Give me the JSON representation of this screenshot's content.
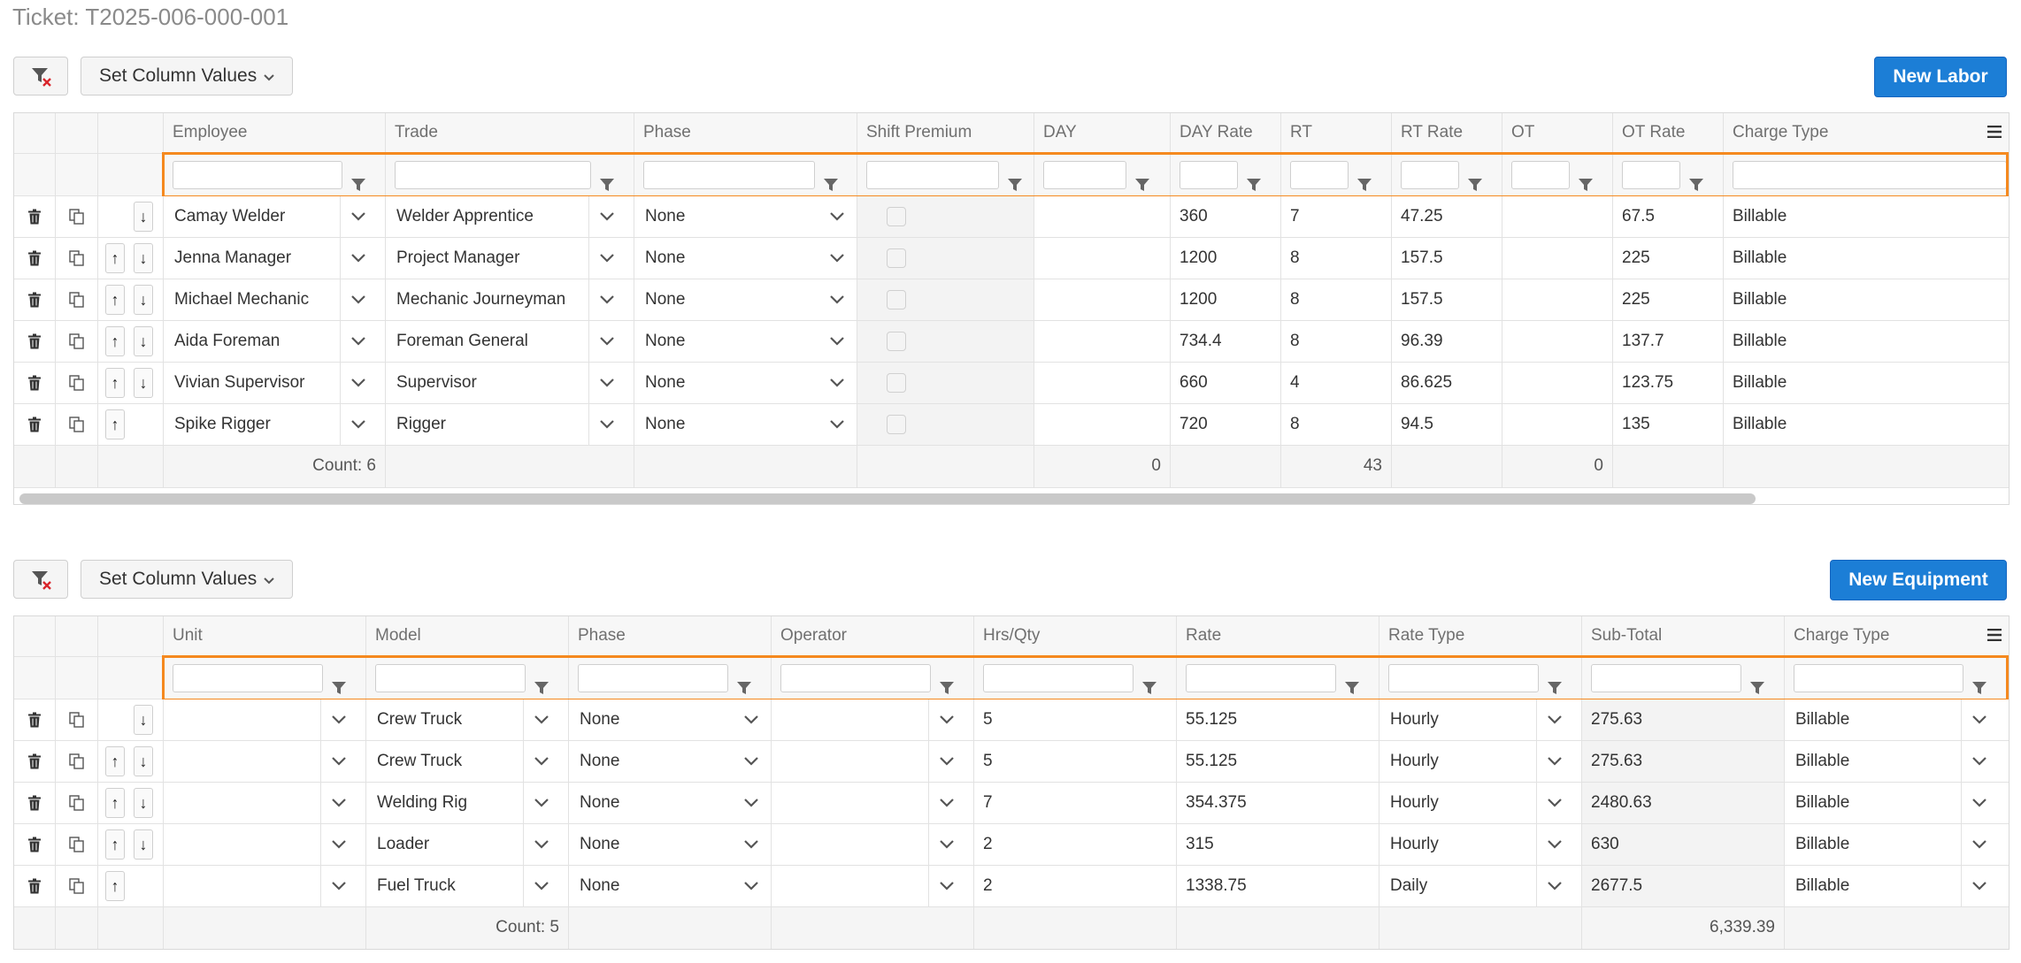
{
  "ticket_label": "Ticket: T2025-006-000-001",
  "colors": {
    "accent": "#1c7ed6",
    "filter_highlight": "#f5891f"
  },
  "labor": {
    "set_column_values": "Set Column Values",
    "new_button": "New Labor",
    "headers": [
      "Employee",
      "Trade",
      "Phase",
      "Shift Premium",
      "DAY",
      "DAY Rate",
      "RT",
      "RT Rate",
      "OT",
      "OT Rate",
      "Charge Type"
    ],
    "rows": [
      {
        "employee": "Camay Welder",
        "trade": "Welder Apprentice",
        "phase": "None",
        "day": "",
        "day_rate": "360",
        "rt": "7",
        "rt_rate": "47.25",
        "ot": "",
        "ot_rate": "67.5",
        "charge": "Billable"
      },
      {
        "employee": "Jenna Manager",
        "trade": "Project Manager",
        "phase": "None",
        "day": "",
        "day_rate": "1200",
        "rt": "8",
        "rt_rate": "157.5",
        "ot": "",
        "ot_rate": "225",
        "charge": "Billable"
      },
      {
        "employee": "Michael Mechanic",
        "trade": "Mechanic Journeyman",
        "phase": "None",
        "day": "",
        "day_rate": "1200",
        "rt": "8",
        "rt_rate": "157.5",
        "ot": "",
        "ot_rate": "225",
        "charge": "Billable"
      },
      {
        "employee": "Aida Foreman",
        "trade": "Foreman General",
        "phase": "None",
        "day": "",
        "day_rate": "734.4",
        "rt": "8",
        "rt_rate": "96.39",
        "ot": "",
        "ot_rate": "137.7",
        "charge": "Billable"
      },
      {
        "employee": "Vivian Supervisor",
        "trade": "Supervisor",
        "phase": "None",
        "day": "",
        "day_rate": "660",
        "rt": "4",
        "rt_rate": "86.625",
        "ot": "",
        "ot_rate": "123.75",
        "charge": "Billable"
      },
      {
        "employee": "Spike Rigger",
        "trade": "Rigger",
        "phase": "None",
        "day": "",
        "day_rate": "720",
        "rt": "8",
        "rt_rate": "94.5",
        "ot": "",
        "ot_rate": "135",
        "charge": "Billable"
      }
    ],
    "footer": {
      "count": "Count: 6",
      "day_total": "0",
      "rt_total": "43",
      "ot_total": "0"
    }
  },
  "equipment": {
    "set_column_values": "Set Column Values",
    "new_button": "New Equipment",
    "headers": [
      "Unit",
      "Model",
      "Phase",
      "Operator",
      "Hrs/Qty",
      "Rate",
      "Rate Type",
      "Sub-Total",
      "Charge Type"
    ],
    "rows": [
      {
        "unit": "",
        "model": "Crew Truck",
        "phase": "None",
        "operator": "",
        "qty": "5",
        "rate": "55.125",
        "rate_type": "Hourly",
        "subtotal": "275.63",
        "charge": "Billable"
      },
      {
        "unit": "",
        "model": "Crew Truck",
        "phase": "None",
        "operator": "",
        "qty": "5",
        "rate": "55.125",
        "rate_type": "Hourly",
        "subtotal": "275.63",
        "charge": "Billable"
      },
      {
        "unit": "",
        "model": "Welding Rig",
        "phase": "None",
        "operator": "",
        "qty": "7",
        "rate": "354.375",
        "rate_type": "Hourly",
        "subtotal": "2480.63",
        "charge": "Billable"
      },
      {
        "unit": "",
        "model": "Loader",
        "phase": "None",
        "operator": "",
        "qty": "2",
        "rate": "315",
        "rate_type": "Hourly",
        "subtotal": "630",
        "charge": "Billable"
      },
      {
        "unit": "",
        "model": "Fuel Truck",
        "phase": "None",
        "operator": "",
        "qty": "2",
        "rate": "1338.75",
        "rate_type": "Daily",
        "subtotal": "2677.5",
        "charge": "Billable"
      }
    ],
    "footer": {
      "count": "Count: 5",
      "subtotal_total": "6,339.39"
    }
  }
}
